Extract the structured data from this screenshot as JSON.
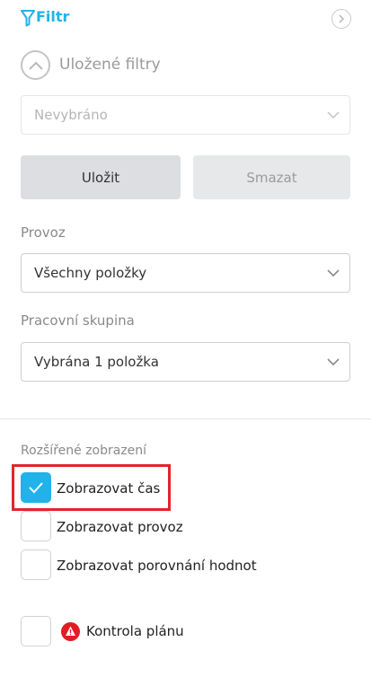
{
  "header": {
    "title": "Filtr"
  },
  "saved_filters": {
    "title": "Uložené filtry",
    "select_value": "Nevybráno",
    "save_label": "Uložit",
    "delete_label": "Smazat"
  },
  "provoz": {
    "label": "Provoz",
    "value": "Všechny položky"
  },
  "pracovni_skupina": {
    "label": "Pracovní skupina",
    "value": "Vybrána 1 položka"
  },
  "extended": {
    "title": "Rozšířené zobrazení",
    "options": [
      {
        "label": "Zobrazovat čas",
        "checked": true
      },
      {
        "label": "Zobrazovat provoz",
        "checked": false
      },
      {
        "label": "Zobrazovat porovnání hodnot",
        "checked": false
      }
    ]
  },
  "plan_check": {
    "label": "Kontrola plánu",
    "checked": false,
    "icon": "warning-icon"
  },
  "colors": {
    "accent": "#21b2ea",
    "warning": "#e31b23",
    "highlight": "#e2252a"
  }
}
